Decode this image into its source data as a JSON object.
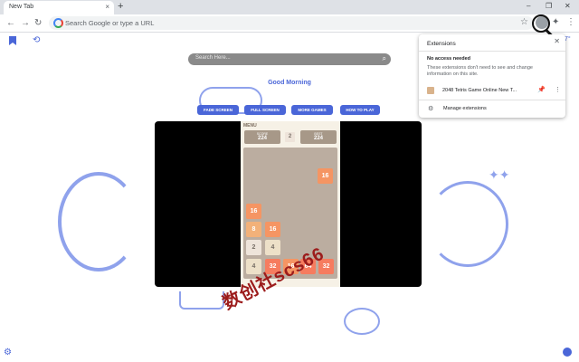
{
  "browser": {
    "tab_title": "New Tab",
    "tab_close": "×",
    "new_tab": "+",
    "win_min": "–",
    "win_max": "❐",
    "win_close": "✕",
    "omnibox_placeholder": "Search Google or type a URL"
  },
  "page": {
    "search_placeholder": "Search Here...",
    "greeting": "Good Morning",
    "buttons": [
      {
        "label": "FADE SCREEN"
      },
      {
        "label": "FULL SCREEN"
      },
      {
        "label": "MORE GAMES"
      },
      {
        "label": "HOW TO PLAY"
      }
    ],
    "weather_temp": "7°"
  },
  "game": {
    "menu": "MENU",
    "score_label": "SCORE",
    "score_value": "224",
    "best_label": "BEST",
    "best_value": "224",
    "next_tile": "2",
    "tiles": [
      {
        "value": "16"
      },
      {
        "value": "16"
      },
      {
        "value": "8"
      },
      {
        "value": "16"
      },
      {
        "value": "2"
      },
      {
        "value": "4"
      },
      {
        "value": "4"
      },
      {
        "value": "32"
      },
      {
        "value": "16"
      },
      {
        "value": "64"
      },
      {
        "value": "32"
      }
    ]
  },
  "extensions_popup": {
    "title": "Extensions",
    "close": "✕",
    "subtitle": "No access needed",
    "description": "These extensions don't need to see and change information on this site.",
    "extension_name": "2048 Tetris Game Online New T...",
    "manage_label": "Manage extensions"
  },
  "watermark": "数创社scs66",
  "colors": {
    "accent": "#4a66d8",
    "tile_16": "#f59563",
    "tile_32": "#f67c5f",
    "watermark": "#9c1c1c"
  }
}
